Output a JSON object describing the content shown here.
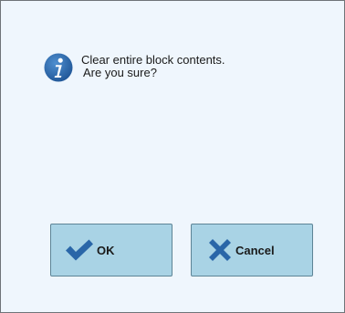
{
  "dialog": {
    "icon": "info-icon",
    "message_line1": "Clear entire block contents.",
    "message_line2": "Are you sure?",
    "ok_label": "OK",
    "ok_icon": "checkmark-icon",
    "cancel_label": "Cancel",
    "cancel_icon": "x-mark-icon"
  },
  "colors": {
    "background": "#eff6fd",
    "button_fill": "#a9d3e5",
    "icon_blue": "#2a66a8"
  }
}
